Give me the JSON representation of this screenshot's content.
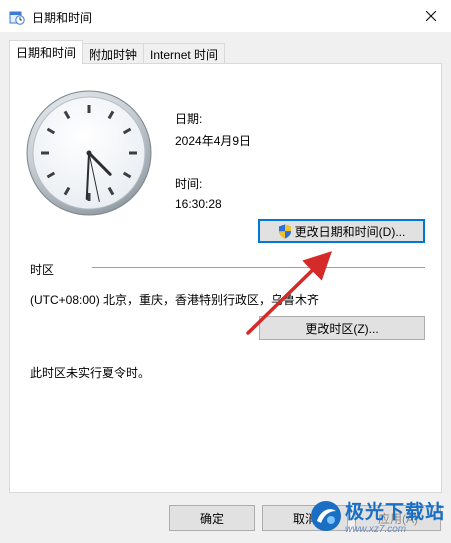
{
  "window": {
    "title": "日期和时间"
  },
  "tabs": [
    {
      "label": "日期和时间",
      "active": true
    },
    {
      "label": "附加时钟",
      "active": false
    },
    {
      "label": "Internet 时间",
      "active": false
    }
  ],
  "date_section": {
    "date_label": "日期:",
    "date_value": "2024年4月9日",
    "time_label": "时间:",
    "time_value": "16:30:28",
    "change_button": "更改日期和时间(D)..."
  },
  "clock": {
    "hour": 16,
    "minute": 30,
    "second": 28
  },
  "timezone_section": {
    "heading": "时区",
    "value": "(UTC+08:00) 北京，重庆，香港特别行政区，乌鲁木齐",
    "change_button": "更改时区(Z)...",
    "dst_note": "此时区未实行夏令时。"
  },
  "footer": {
    "ok": "确定",
    "cancel": "取消",
    "apply": "应用(A)"
  },
  "watermark": {
    "name": "极光下载站",
    "url": "www.xz7.com"
  },
  "colors": {
    "accent": "#0078d7",
    "annotation_arrow": "#d42a2a",
    "watermark_blue": "#1a6fc4"
  }
}
